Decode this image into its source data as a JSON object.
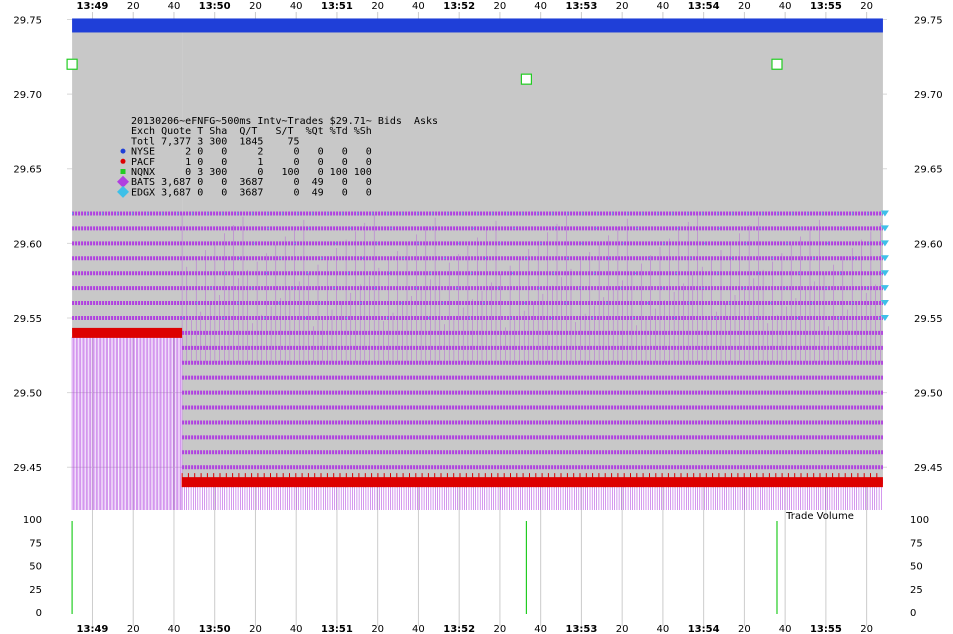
{
  "chart_data": {
    "type": "line",
    "title": "20130206~eFNFG~500ms Intv~Trades $29.71~ Bids  Asks",
    "time_axis": {
      "labels": [
        "13:49",
        "20",
        "40",
        "13:50",
        "20",
        "40",
        "13:51",
        "20",
        "40",
        "13:52",
        "20",
        "40",
        "13:53",
        "20",
        "40",
        "13:54",
        "20",
        "40",
        "13:55",
        "20"
      ],
      "values_sec": [
        0,
        20,
        40,
        60,
        80,
        100,
        120,
        140,
        160,
        180,
        200,
        220,
        240,
        260,
        280,
        300,
        320,
        340,
        360,
        380
      ],
      "range_sec": [
        -12.5,
        390
      ]
    },
    "price_axis": {
      "ticks": [
        "29.75",
        "29.70",
        "29.65",
        "29.60",
        "29.55",
        "29.50",
        "29.45"
      ],
      "tick_values": [
        29.75,
        29.7,
        29.65,
        29.6,
        29.55,
        29.5,
        29.45
      ],
      "range": [
        29.42,
        29.755
      ]
    },
    "volume_axis": {
      "title": "Trade Volume",
      "ticks": [
        "100",
        "75",
        "50",
        "25",
        "0"
      ],
      "tick_values": [
        100,
        75,
        50,
        25,
        0
      ],
      "range": [
        0,
        100
      ]
    },
    "table": {
      "header": "Exch Quote T Sha  Q/T   S/T  %Qt %Td %Sh",
      "total": "Totl 7,377 3 300  1845    75",
      "rows": [
        {
          "text": "NYSE     2 0   0     2     0   0   0   0",
          "color": "#1f3fd8",
          "marker": "circle"
        },
        {
          "text": "PACF     1 0   0     1     0   0   0   0",
          "color": "#dd0000",
          "marker": "circle"
        },
        {
          "text": "NQNX     0 3 300     0   100   0 100 100",
          "color": "#22cc22",
          "marker": "square"
        },
        {
          "text": "BATS 3,687 0   0  3687     0  49   0   0",
          "color": "#b040e0",
          "marker": "diamond"
        },
        {
          "text": "EDGX 3,687 0   0  3687     0  49   0   0",
          "color": "#3ec0e8",
          "marker": "diamond"
        }
      ]
    },
    "series": [
      {
        "name": "NQNX",
        "kind": "trades",
        "color": "#22cc22",
        "points": [
          {
            "t": -10,
            "price": 29.72,
            "volume": 100
          },
          {
            "t": 213,
            "price": 29.71,
            "volume": 100
          },
          {
            "t": 336,
            "price": 29.72,
            "volume": 100
          }
        ]
      },
      {
        "name": "NYSE",
        "kind": "ask",
        "color": "#1f3fd8",
        "level": 29.75,
        "t_range": [
          -10,
          388
        ]
      },
      {
        "name": "PACF",
        "kind": "bid",
        "color": "#dd0000",
        "segments": [
          {
            "t_range": [
              -10,
              44
            ],
            "price": 29.54
          },
          {
            "t_range": [
              44,
              388
            ],
            "price": 29.44
          }
        ]
      },
      {
        "name": "BATS",
        "kind": "quotes",
        "color": "#b040e0",
        "bid_levels": [
          29.44,
          29.45,
          29.46,
          29.47,
          29.48,
          29.49,
          29.5,
          29.51,
          29.52,
          29.53,
          29.54,
          29.55,
          29.56,
          29.57,
          29.58,
          29.59,
          29.6,
          29.61,
          29.62
        ]
      },
      {
        "name": "EDGX",
        "kind": "quotes",
        "color": "#3ec0e8",
        "ask_level": 29.62,
        "bid_levels": [
          29.55,
          29.56,
          29.57,
          29.58,
          29.59,
          29.6,
          29.61
        ]
      }
    ],
    "grid": true,
    "legend": "top-left"
  }
}
